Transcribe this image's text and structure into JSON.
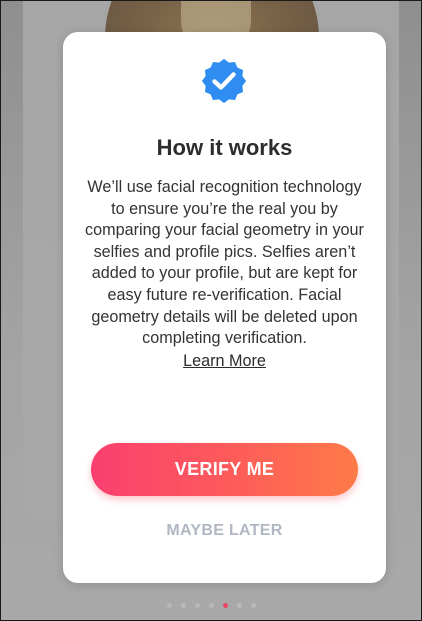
{
  "modal": {
    "title": "How it works",
    "body": "We’ll use facial recognition technology to ensure you’re the real you by comparing your facial geometry in your selfies and profile pics. Selfies aren’t added to your profile, but are kept for easy future re-verification. Facial geometry details will be deleted upon completing verification.",
    "learn_more_label": "Learn More",
    "verify_label": "VERIFY ME",
    "later_label": "MAYBE LATER",
    "badge_icon": "verified-check-icon"
  },
  "colors": {
    "badge_blue": "#2f8cf0",
    "verify_gradient_start": "#fa3f70",
    "verify_gradient_end": "#fe7a48",
    "maybe_later_text": "#b1b7c2",
    "active_dot": "#e74a5e"
  },
  "pagination": {
    "count": 7,
    "active_index": 4
  }
}
